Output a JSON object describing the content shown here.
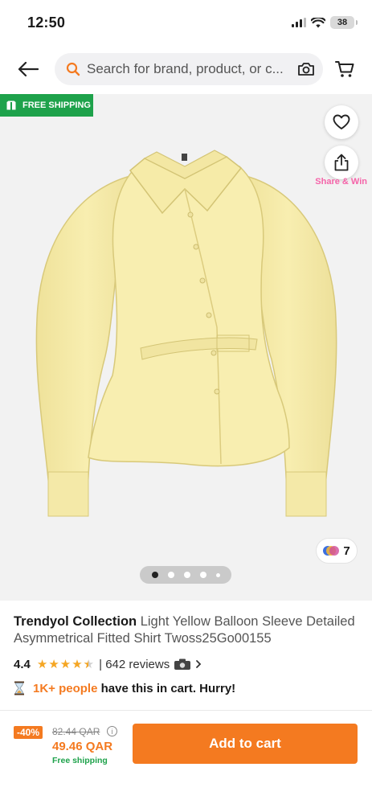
{
  "status_bar": {
    "time": "12:50",
    "battery": "38"
  },
  "header": {
    "search_placeholder": "Search for brand, product, or c..."
  },
  "gallery": {
    "free_shipping_tag": "FREE SHIPPING",
    "share_label": "Share & Win",
    "color_count": "7",
    "image_count": 5,
    "active_image": 1
  },
  "product": {
    "brand": "Trendyol Collection",
    "name": "Light Yellow Balloon Sleeve Detailed Asymmetrical Fitted Shirt Twoss25Go00155",
    "rating": "4.4",
    "rating_value": 4.4,
    "reviews": "| 642 reviews",
    "cart_people": "1K+ people",
    "cart_message": "have this in cart. Hurry!"
  },
  "purchase": {
    "discount": "-40%",
    "old_price": "82.44 QAR",
    "new_price": "49.46 QAR",
    "shipping": "Free shipping",
    "add_to_cart": "Add to cart"
  },
  "colors": {
    "accent": "#f47a20",
    "green": "#1ea24b",
    "share_pink": "#f564a9",
    "gallery_bg": "#f2f2f2",
    "shirt": "#f8eeb0"
  }
}
